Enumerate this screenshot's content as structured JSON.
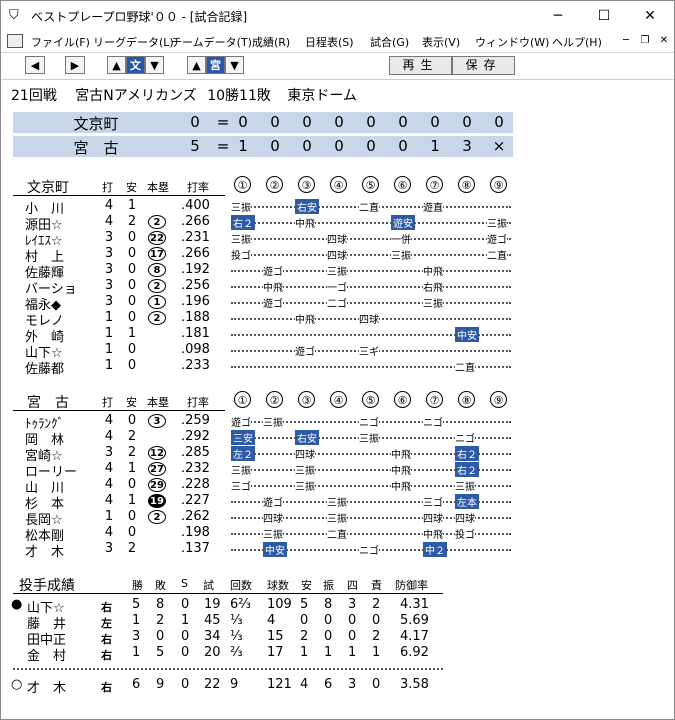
{
  "window": {
    "title": "ベストプレープロ野球'００ - [試合記録]",
    "icon": "baseball-cap-icon"
  },
  "menu": [
    "ファイル(F)",
    "リーグデータ(L)",
    "チームデータ(T)",
    "成績(R)",
    "日程表(S)",
    "試合(G)",
    "表示(V)",
    "ウィンドウ(W)",
    "ヘルプ(H)"
  ],
  "toolbar": {
    "left": "◀",
    "right": "▶",
    "up": "▲",
    "team_a": "文",
    "down": "▼",
    "team_b": "宮",
    "play": "再生",
    "save": "保存"
  },
  "game": {
    "round": "21回戦",
    "teams": "宮古Nアメリカンズ",
    "record": "10勝11敗",
    "stadium": "東京ドーム"
  },
  "scoreboard": [
    {
      "team": "文京町",
      "total": "0",
      "eq": "=",
      "innings": [
        "0",
        "0",
        "0",
        "0",
        "0",
        "0",
        "0",
        "0",
        "0"
      ]
    },
    {
      "team": "宮　古",
      "total": "5",
      "eq": "=",
      "innings": [
        "1",
        "0",
        "0",
        "0",
        "0",
        "0",
        "1",
        "3",
        "×"
      ]
    }
  ],
  "batting_headers": {
    "ab": "打",
    "h": "安",
    "hr": "本塁",
    "avg": "打率",
    "innings": [
      "①",
      "②",
      "③",
      "④",
      "⑤",
      "⑥",
      "⑦",
      "⑧",
      "⑨"
    ]
  },
  "away": {
    "name": "文京町",
    "players": [
      {
        "name": "小　川",
        "ab": "4",
        "h": "1",
        "hr": "",
        "avg": ".400"
      },
      {
        "name": "源田☆",
        "ab": "4",
        "h": "2",
        "hr": "2",
        "avg": ".266"
      },
      {
        "name": "ﾚｲｴｽ☆",
        "ab": "3",
        "h": "0",
        "hr": "22",
        "avg": ".231"
      },
      {
        "name": "村　上",
        "ab": "3",
        "h": "0",
        "hr": "17",
        "avg": ".266"
      },
      {
        "name": "佐藤輝",
        "ab": "3",
        "h": "0",
        "hr": "8",
        "avg": ".192"
      },
      {
        "name": "バーショ",
        "ab": "3",
        "h": "0",
        "hr": "2",
        "avg": ".256"
      },
      {
        "name": "福永◆",
        "ab": "3",
        "h": "0",
        "hr": "1",
        "avg": ".196"
      },
      {
        "name": "モレノ",
        "ab": "1",
        "h": "0",
        "hr": "2",
        "avg": ".188"
      },
      {
        "name": "外　崎",
        "ab": "1",
        "h": "1",
        "hr": "",
        "avg": ".181"
      },
      {
        "name": "山下☆",
        "ab": "1",
        "h": "0",
        "hr": "",
        "avg": ".098"
      },
      {
        "name": "佐藤都",
        "ab": "1",
        "h": "0",
        "hr": "",
        "avg": ".233"
      }
    ]
  },
  "home": {
    "name": "宮　古",
    "players": [
      {
        "name": "ﾄｩﾗﾝｸﾞ",
        "ab": "4",
        "h": "0",
        "hr": "3",
        "avg": ".259"
      },
      {
        "name": "岡　林",
        "ab": "4",
        "h": "2",
        "hr": "",
        "avg": ".292"
      },
      {
        "name": "宮崎☆",
        "ab": "3",
        "h": "2",
        "hr": "12",
        "avg": ".285"
      },
      {
        "name": "ローリー",
        "ab": "4",
        "h": "1",
        "hr": "27",
        "avg": ".232"
      },
      {
        "name": "山　川",
        "ab": "4",
        "h": "0",
        "hr": "29",
        "avg": ".228"
      },
      {
        "name": "杉　本",
        "ab": "4",
        "h": "1",
        "hr": "19",
        "avg": ".227"
      },
      {
        "name": "長岡☆",
        "ab": "1",
        "h": "0",
        "hr": "2",
        "avg": ".262"
      },
      {
        "name": "松本剛",
        "ab": "4",
        "h": "0",
        "hr": "",
        "avg": ".198"
      },
      {
        "name": "才　木",
        "ab": "3",
        "h": "2",
        "hr": "",
        "avg": ".137"
      }
    ]
  },
  "away_atbats": [
    [
      [
        0,
        "三振"
      ],
      [
        2,
        "右安",
        true
      ],
      [
        4,
        "二直"
      ],
      [
        6,
        "遊直"
      ]
    ],
    [
      [
        0,
        "右２",
        true
      ],
      [
        2,
        "中飛"
      ],
      [
        5,
        "遊安",
        true
      ],
      [
        8,
        "三振"
      ]
    ],
    [
      [
        0,
        "三振"
      ],
      [
        3,
        "四球"
      ],
      [
        5,
        "一併"
      ],
      [
        8,
        "遊ゴ"
      ]
    ],
    [
      [
        0,
        "投ゴ"
      ],
      [
        3,
        "四球"
      ],
      [
        5,
        "三振"
      ],
      [
        8,
        "二直"
      ]
    ],
    [
      [
        1,
        "遊ゴ"
      ],
      [
        3,
        "三振"
      ],
      [
        6,
        "中飛"
      ]
    ],
    [
      [
        1,
        "中飛"
      ],
      [
        3,
        "一ゴ"
      ],
      [
        6,
        "右飛"
      ]
    ],
    [
      [
        1,
        "遊ゴ"
      ],
      [
        3,
        "二ゴ"
      ],
      [
        6,
        "三振"
      ]
    ],
    [
      [
        2,
        "中飛"
      ],
      [
        4,
        "四球"
      ]
    ],
    [
      [
        7,
        "中安",
        true
      ]
    ],
    [
      [
        2,
        "遊ゴ"
      ],
      [
        4,
        "三ギ"
      ]
    ],
    [
      [
        7,
        "二直"
      ]
    ]
  ],
  "home_atbats": [
    [
      [
        0,
        "遊ゴ"
      ],
      [
        1,
        "三振"
      ],
      [
        4,
        "ニゴ"
      ],
      [
        6,
        "ニゴ"
      ]
    ],
    [
      [
        0,
        "三安",
        true
      ],
      [
        2,
        "右安",
        true
      ],
      [
        4,
        "三振"
      ],
      [
        7,
        "ニゴ"
      ]
    ],
    [
      [
        0,
        "左２",
        true
      ],
      [
        2,
        "四球"
      ],
      [
        5,
        "中飛"
      ],
      [
        7,
        "右２",
        true
      ]
    ],
    [
      [
        0,
        "三振"
      ],
      [
        2,
        "三振"
      ],
      [
        5,
        "中飛"
      ],
      [
        7,
        "右２",
        true
      ]
    ],
    [
      [
        0,
        "三ゴ"
      ],
      [
        2,
        "三振"
      ],
      [
        5,
        "中飛"
      ],
      [
        7,
        "三振"
      ]
    ],
    [
      [
        1,
        "遊ゴ"
      ],
      [
        3,
        "三振"
      ],
      [
        6,
        "三ゴ"
      ],
      [
        7,
        "左本",
        true
      ]
    ],
    [
      [
        1,
        "四球"
      ],
      [
        3,
        "三振"
      ],
      [
        6,
        "四球"
      ],
      [
        7,
        "四球"
      ]
    ],
    [
      [
        1,
        "三振"
      ],
      [
        3,
        "二直"
      ],
      [
        6,
        "中飛"
      ],
      [
        7,
        "投ゴ"
      ]
    ],
    [
      [
        1,
        "中安",
        true
      ],
      [
        4,
        "ニゴ"
      ],
      [
        6,
        "中２",
        true
      ]
    ]
  ],
  "pitching": {
    "title": "投手成績",
    "headers": {
      "w": "勝",
      "l": "敗",
      "s": "S",
      "g": "試",
      "ip": "回数",
      "np": "球数",
      "h": "安",
      "so": "振",
      "bb": "四",
      "er": "責",
      "era": "防御率"
    },
    "rows": [
      {
        "mark": "●",
        "name": "山下☆",
        "hand": "右",
        "w": "5",
        "l": "8",
        "s": "0",
        "g": "19",
        "ip": "6⅔",
        "np": "109",
        "h": "5",
        "so": "8",
        "bb": "3",
        "er": "2",
        "era": "4.31"
      },
      {
        "mark": "",
        "name": "藤　井",
        "hand": "左",
        "w": "1",
        "l": "2",
        "s": "1",
        "g": "45",
        "ip": "⅓",
        "np": "4",
        "h": "0",
        "so": "0",
        "bb": "0",
        "er": "0",
        "era": "5.69"
      },
      {
        "mark": "",
        "name": "田中正",
        "hand": "右",
        "w": "3",
        "l": "0",
        "s": "0",
        "g": "34",
        "ip": "⅓",
        "np": "15",
        "h": "2",
        "so": "0",
        "bb": "0",
        "er": "2",
        "era": "4.17"
      },
      {
        "mark": "",
        "name": "金　村",
        "hand": "右",
        "w": "1",
        "l": "5",
        "s": "0",
        "g": "20",
        "ip": "⅔",
        "np": "17",
        "h": "1",
        "so": "1",
        "bb": "1",
        "er": "1",
        "era": "6.92"
      }
    ],
    "winner": {
      "mark": "○",
      "name": "才　木",
      "hand": "右",
      "w": "6",
      "l": "9",
      "s": "0",
      "g": "22",
      "ip": "9",
      "np": "121",
      "h": "4",
      "so": "6",
      "bb": "3",
      "er": "0",
      "era": "3.58"
    }
  },
  "colors": {
    "highlight": "#2f5aa6",
    "score_bg": "#c9d6ea"
  }
}
